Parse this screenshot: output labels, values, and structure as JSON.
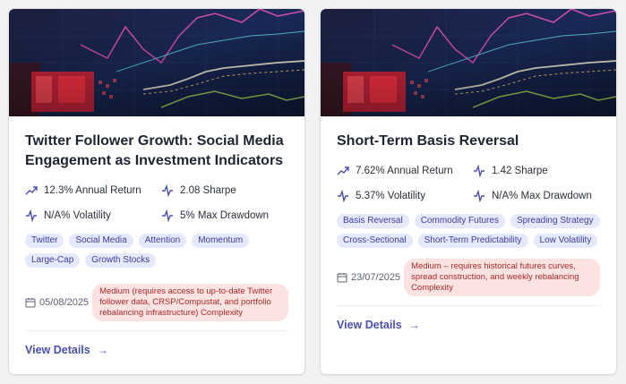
{
  "colors": {
    "accent": "#4a4fa8",
    "tag_bg": "#e6e8fb",
    "complexity_bg": "#fde2e2",
    "complexity_text": "#a52a2a"
  },
  "cards": [
    {
      "title": "Twitter Follower Growth: Social Media Engagement as Investment Indicators",
      "metrics": {
        "annual_return": "12.3% Annual Return",
        "sharpe": "2.08 Sharpe",
        "volatility": "N/A% Volatility",
        "max_drawdown": "5% Max Drawdown"
      },
      "tags": [
        "Twitter",
        "Social Media",
        "Attention",
        "Momentum",
        "Large-Cap",
        "Growth Stocks"
      ],
      "date": "05/08/2025",
      "complexity": "Medium (requires access to up-to-date Twitter follower data, CRSP/Compustat, and portfolio rebalancing infrastructure) Complexity",
      "view_label": "View Details",
      "arrow_icon": "arrow-right-icon"
    },
    {
      "title": "Short-Term Basis Reversal",
      "metrics": {
        "annual_return": "7.62% Annual Return",
        "sharpe": "1.42 Sharpe",
        "volatility": "5.37% Volatility",
        "max_drawdown": "N/A% Max Drawdown"
      },
      "tags": [
        "Basis Reversal",
        "Commodity Futures",
        "Spreading Strategy",
        "Cross-Sectional",
        "Short-Term Predictability",
        "Low Volatility"
      ],
      "date": "23/07/2025",
      "complexity": "Medium – requires historical futures curves, spread construction, and weekly rebalancing Complexity",
      "view_label": "View Details",
      "arrow_icon": "arrow-right-icon"
    }
  ]
}
